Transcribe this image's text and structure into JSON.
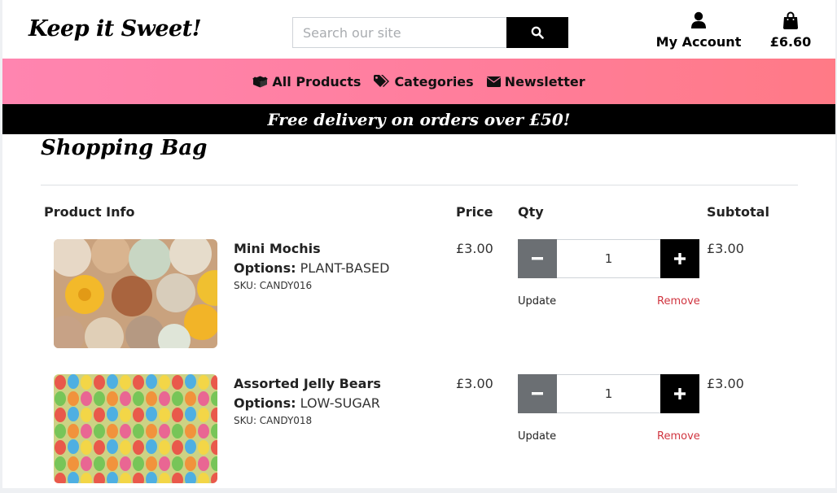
{
  "header": {
    "logo": "Keep it Sweet!",
    "search_placeholder": "Search our site",
    "account_label": "My Account",
    "bag_total": "£6.60"
  },
  "nav": {
    "items": [
      {
        "label": "All Products",
        "icon": "boxes-icon"
      },
      {
        "label": "Categories",
        "icon": "tags-icon"
      },
      {
        "label": "Newsletter",
        "icon": "envelope-icon"
      }
    ]
  },
  "promo": "Free delivery on orders over £50!",
  "page_title": "Shopping Bag",
  "table": {
    "headers": {
      "product": "Product Info",
      "price": "Price",
      "qty": "Qty",
      "subtotal": "Subtotal"
    },
    "rows": [
      {
        "name": "Mini Mochis",
        "options_label": "Options:",
        "options_value": "PLANT-BASED",
        "sku": "SKU: CANDY016",
        "price": "£3.00",
        "qty": "1",
        "subtotal": "£3.00",
        "update": "Update",
        "remove": "Remove"
      },
      {
        "name": "Assorted Jelly Bears",
        "options_label": "Options:",
        "options_value": "LOW-SUGAR",
        "sku": "SKU: CANDY018",
        "price": "£3.00",
        "qty": "1",
        "subtotal": "£3.00",
        "update": "Update",
        "remove": "Remove"
      }
    ]
  },
  "colors": {
    "nav_gradient_start": "#ff85b0",
    "nav_gradient_end": "#ff7a86",
    "remove_link": "#d0343f",
    "minus_button": "#6b6f73",
    "plus_button": "#000000"
  }
}
